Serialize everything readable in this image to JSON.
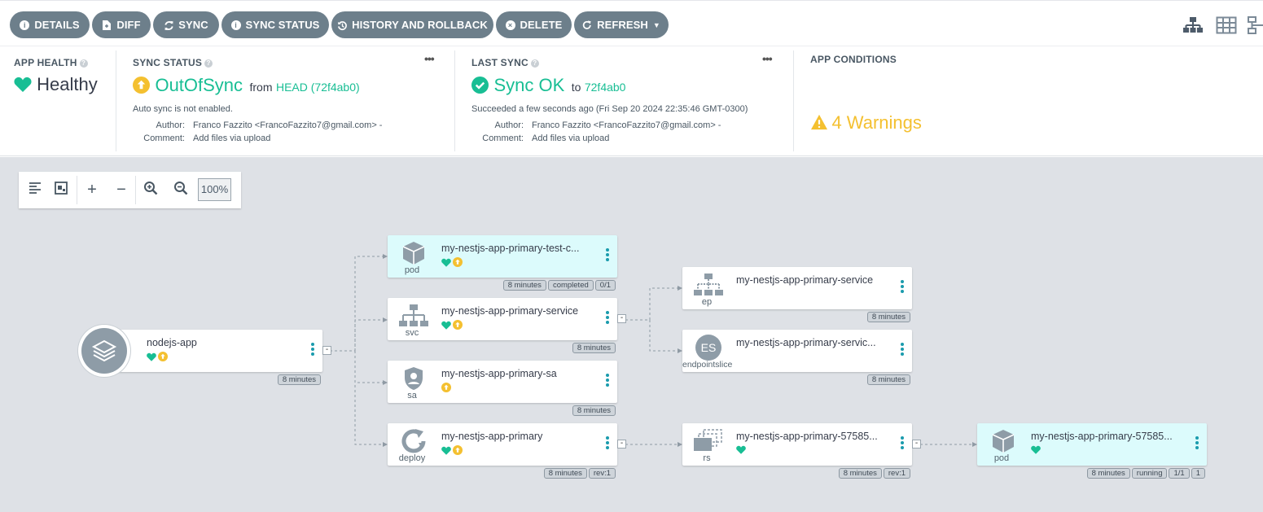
{
  "toolbar": {
    "buttons": [
      {
        "label": "DETAILS",
        "icon": "info-icon"
      },
      {
        "label": "DIFF",
        "icon": "file-diff-icon"
      },
      {
        "label": "SYNC",
        "icon": "sync-icon"
      },
      {
        "label": "SYNC STATUS",
        "icon": "info-icon"
      },
      {
        "label": "HISTORY AND ROLLBACK",
        "icon": "history-icon"
      },
      {
        "label": "DELETE",
        "icon": "delete-icon"
      },
      {
        "label": "REFRESH",
        "icon": "refresh-icon"
      }
    ],
    "view_icons": [
      "tree-view-icon",
      "grid-view-icon",
      "network-view-icon"
    ]
  },
  "app_health": {
    "title": "APP HEALTH",
    "value": "Healthy",
    "color": "#18be94"
  },
  "sync_status": {
    "title": "SYNC STATUS",
    "value": "OutOfSync",
    "from_label": "from",
    "revision": "HEAD (72f4ab0)",
    "auto_sync": "Auto sync is not enabled.",
    "author_label": "Author:",
    "author": "Franco Fazzito <FrancoFazzito7@gmail.com> -",
    "comment_label": "Comment:",
    "comment": "Add files via upload",
    "color": "#f4c030",
    "text_color": "#18be94"
  },
  "last_sync": {
    "title": "LAST SYNC",
    "value": "Sync OK",
    "to_label": "to",
    "revision": "72f4ab0",
    "detail": "Succeeded a few seconds ago (Fri Sep 20 2024 22:35:46 GMT-0300)",
    "author_label": "Author:",
    "author": "Franco Fazzito <FrancoFazzito7@gmail.com> -",
    "comment_label": "Comment:",
    "comment": "Add files via upload"
  },
  "app_conditions": {
    "title": "APP CONDITIONS",
    "value": "4 Warnings",
    "color": "#f4c030"
  },
  "zoom": {
    "level": "100%"
  },
  "nodes": {
    "app": {
      "name": "nodejs-app",
      "tags": [
        "8 minutes"
      ]
    },
    "pod1": {
      "name": "my-nestjs-app-primary-test-c...",
      "kind": "pod",
      "tags": [
        "8 minutes",
        "completed",
        "0/1"
      ]
    },
    "svc": {
      "name": "my-nestjs-app-primary-service",
      "kind": "svc",
      "tags": [
        "8 minutes"
      ]
    },
    "sa": {
      "name": "my-nestjs-app-primary-sa",
      "kind": "sa",
      "tags": [
        "8 minutes"
      ]
    },
    "deploy": {
      "name": "my-nestjs-app-primary",
      "kind": "deploy",
      "tags": [
        "8 minutes",
        "rev:1"
      ]
    },
    "ep": {
      "name": "my-nestjs-app-primary-service",
      "kind": "ep",
      "tags": [
        "8 minutes"
      ]
    },
    "es": {
      "name": "my-nestjs-app-primary-servic...",
      "kind": "endpointslice",
      "icon_text": "ES",
      "tags": [
        "8 minutes"
      ]
    },
    "rs": {
      "name": "my-nestjs-app-primary-57585...",
      "kind": "rs",
      "tags": [
        "8 minutes",
        "rev:1"
      ]
    },
    "pod2": {
      "name": "my-nestjs-app-primary-57585...",
      "kind": "pod",
      "tags": [
        "8 minutes",
        "running",
        "1/1",
        "1"
      ]
    }
  }
}
